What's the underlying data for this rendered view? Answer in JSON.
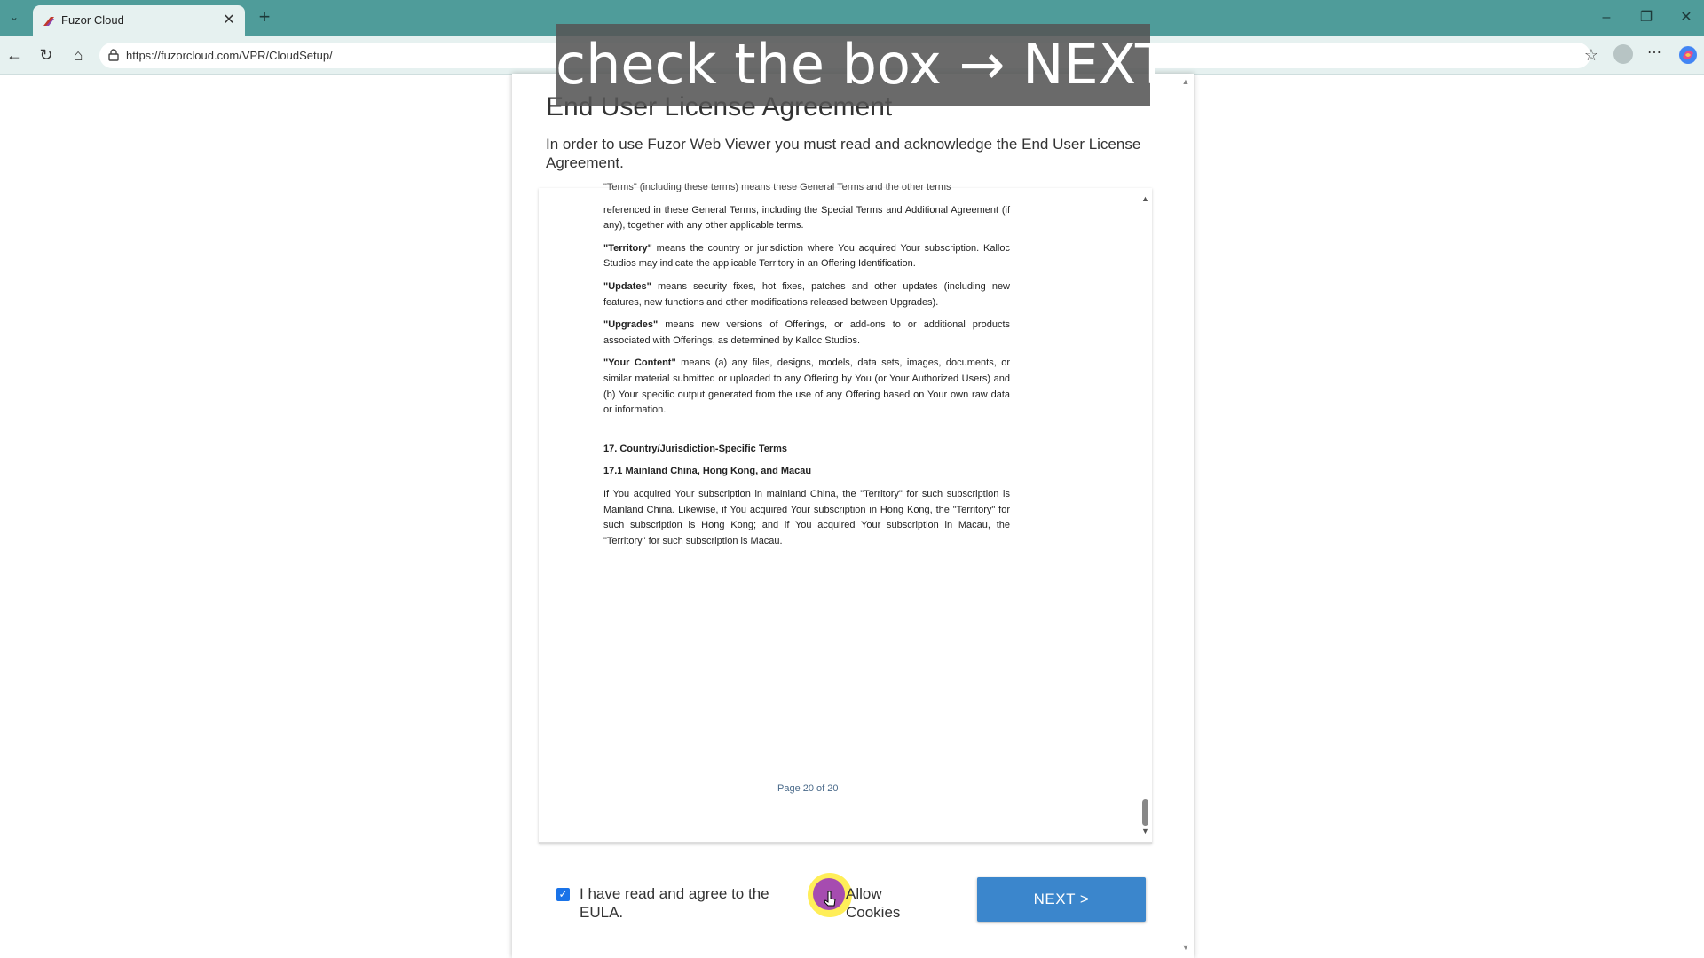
{
  "browser": {
    "tab_title": "Fuzor Cloud",
    "url": "https://fuzorcloud.com/VPR/CloudSetup/"
  },
  "overlay": {
    "caption": "check the box → NEXT"
  },
  "page": {
    "title": "End User License Agreement",
    "intro": "In order to use Fuzor Web Viewer you must read and acknowledge the End User License Agreement.",
    "document": {
      "cut_line": "\"Terms\" (including these terms) means these General Terms and the other terms",
      "para_terms_rest": "referenced in these General Terms, including the Special Terms and Additional Agreement (if any), together with any other applicable terms.",
      "def_territory_term": "\"Territory\"",
      "def_territory_text": " means the country or jurisdiction where You acquired Your subscription. Kalloc Studios may indicate the applicable Territory in an Offering Identification.",
      "def_updates_term": "\"Updates\"",
      "def_updates_text": " means security fixes, hot fixes, patches and other updates (including new features, new functions and other modifications released between Upgrades).",
      "def_upgrades_term": "\"Upgrades\"",
      "def_upgrades_text": " means new versions of Offerings, or add-ons to or additional products associated with Offerings, as determined by Kalloc Studios.",
      "def_content_term": "\"Your Content\"",
      "def_content_text": " means (a) any files, designs, models, data sets, images, documents, or similar material submitted or uploaded to any Offering by You (or Your Authorized Users) and (b) Your specific output generated from the use of any Offering based on Your own raw data or information.",
      "section_17": "17. Country/Jurisdiction-Specific Terms",
      "section_17_1": "17.1 Mainland China, Hong Kong, and Macau",
      "section_17_1_text": "If You acquired Your subscription in mainland China, the \"Territory\" for such subscription is Mainland China. Likewise, if You acquired Your subscription in Hong Kong, the \"Territory\" for such subscription is Hong Kong; and if You acquired Your subscription in Macau, the \"Territory\" for such subscription is Macau.",
      "page_indicator": "Page 20 of 20"
    },
    "eula_checkbox": {
      "label": "I have read and agree to the EULA.",
      "checked": true
    },
    "cookies_checkbox": {
      "label": "Allow Cookies"
    },
    "next_button": "NEXT >"
  },
  "icons": [
    "tab-list-icon",
    "fuzor-favicon-icon",
    "close-icon",
    "plus-icon",
    "minimize-icon",
    "restore-icon",
    "window-close-icon",
    "back-icon",
    "reload-icon",
    "home-icon",
    "lock-icon",
    "star-icon",
    "profile-icon",
    "more-icon",
    "copilot-icon",
    "cursor-icon"
  ],
  "colors": {
    "tabbar": "#4f9c9a",
    "next_button": "#3b86cc",
    "checkbox": "#1a73e8",
    "cursor_highlight": "#ffeb3b"
  }
}
